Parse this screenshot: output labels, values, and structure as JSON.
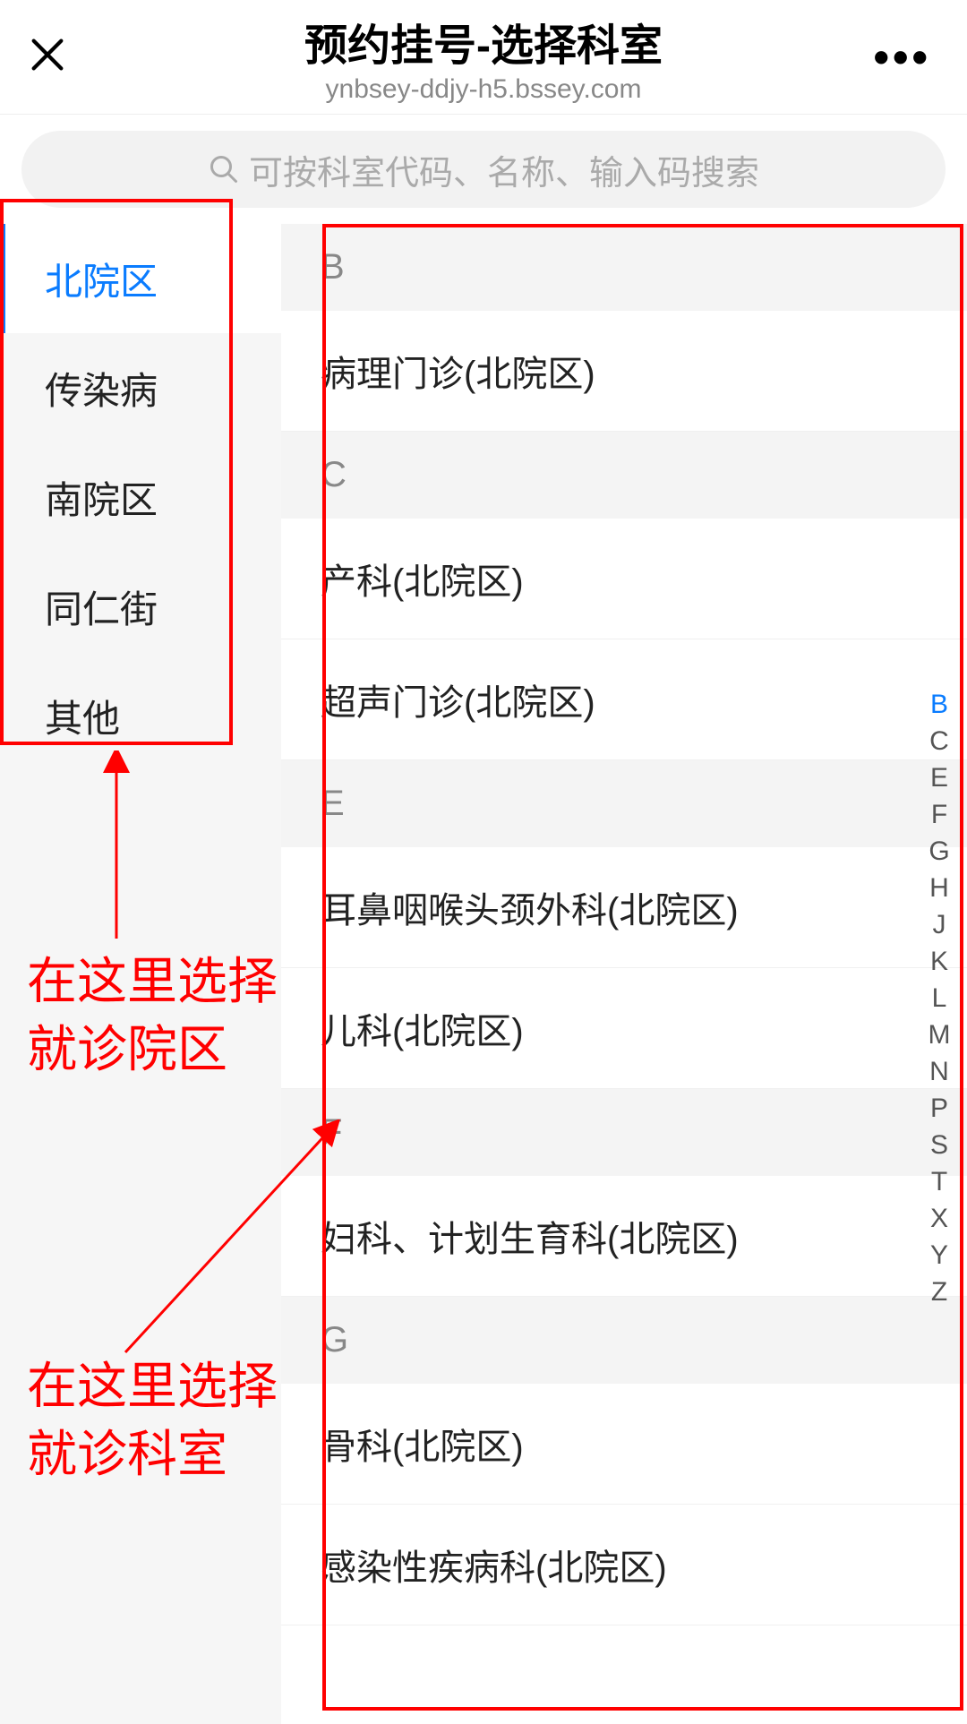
{
  "header": {
    "title": "预约挂号-选择科室",
    "subtitle": "ynbsey-ddjy-h5.bssey.com"
  },
  "search": {
    "placeholder": "可按科室代码、名称、输入码搜索"
  },
  "sidebar": {
    "items": [
      {
        "label": "北院区",
        "active": true
      },
      {
        "label": "传染病",
        "active": false
      },
      {
        "label": "南院区",
        "active": false
      },
      {
        "label": "同仁街",
        "active": false
      },
      {
        "label": "其他",
        "active": false
      }
    ]
  },
  "sections": [
    {
      "letter": "B",
      "depts": [
        "病理门诊(北院区)"
      ]
    },
    {
      "letter": "C",
      "depts": [
        "产科(北院区)",
        "超声门诊(北院区)"
      ]
    },
    {
      "letter": "E",
      "depts": [
        "耳鼻咽喉头颈外科(北院区)",
        "儿科(北院区)"
      ]
    },
    {
      "letter": "F",
      "depts": [
        "妇科、计划生育科(北院区)"
      ]
    },
    {
      "letter": "G",
      "depts": [
        "骨科(北院区)",
        "感染性疾病科(北院区)"
      ]
    }
  ],
  "index_letters": [
    "B",
    "C",
    "E",
    "F",
    "G",
    "H",
    "J",
    "K",
    "L",
    "M",
    "N",
    "P",
    "S",
    "T",
    "X",
    "Y",
    "Z"
  ],
  "index_active": "B",
  "annotations": {
    "sidebar_hint": "在这里选择\n就诊院区",
    "main_hint": "在这里选择\n就诊科室"
  }
}
